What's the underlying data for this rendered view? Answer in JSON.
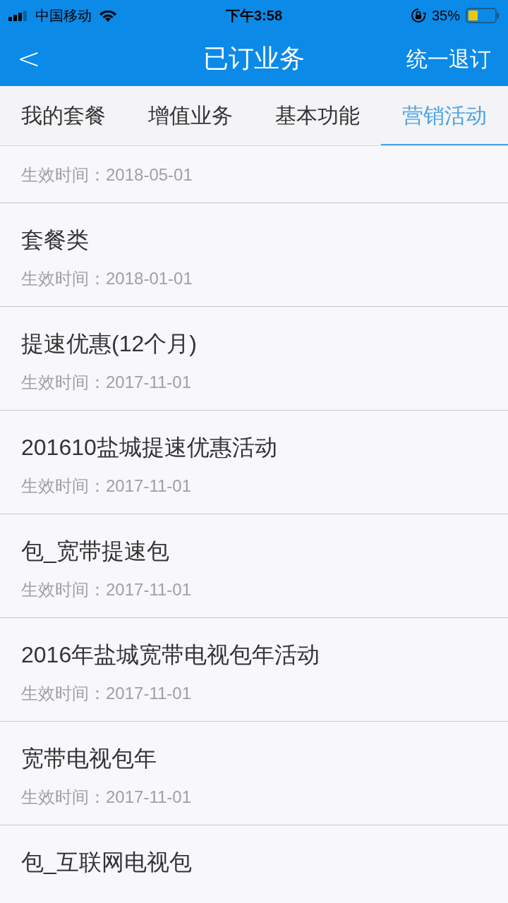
{
  "status_bar": {
    "carrier": "中国移动",
    "time": "下午3:58",
    "battery": "35%"
  },
  "nav": {
    "back": "<",
    "title": "已订业务",
    "action": "统一退订"
  },
  "tabs": [
    {
      "label": "我的套餐",
      "selected": false
    },
    {
      "label": "增值业务",
      "selected": false
    },
    {
      "label": "基本功能",
      "selected": false
    },
    {
      "label": "营销活动",
      "selected": true
    }
  ],
  "items": [
    {
      "date": "生效时间：2018-05-01"
    },
    {
      "name": "套餐类",
      "date": "生效时间：2018-01-01"
    },
    {
      "name": "提速优惠(12个月)",
      "date": "生效时间：2017-11-01"
    },
    {
      "name": "201610盐城提速优惠活动",
      "date": "生效时间：2017-11-01"
    },
    {
      "name": "包_宽带提速包",
      "date": "生效时间：2017-11-01"
    },
    {
      "name": "2016年盐城宽带电视包年活动",
      "date": "生效时间：2017-11-01"
    },
    {
      "name": "宽带电视包年",
      "date": "生效时间：2017-11-01"
    },
    {
      "name": "包_互联网电视包"
    }
  ]
}
